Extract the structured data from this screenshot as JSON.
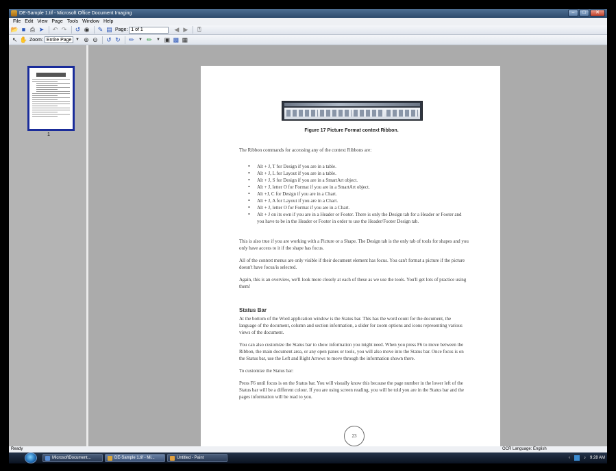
{
  "window": {
    "title": "DE-Sample 1.tif - Microsoft Office Document Imaging"
  },
  "menu": {
    "items": [
      "File",
      "Edit",
      "View",
      "Page",
      "Tools",
      "Window",
      "Help"
    ]
  },
  "toolbar1": {
    "page_label": "Page:",
    "page_value": "1 of 1"
  },
  "toolbar2": {
    "zoom_label": "Zoom:",
    "zoom_value": "Entire Page"
  },
  "thumbnail": {
    "page_number": "1"
  },
  "document": {
    "figure_caption": "Figure 17 Picture Format context Ribbon.",
    "intro": "The Ribbon commands for accessing any of the context Ribbons are:",
    "bullets": [
      "Alt + J, T for Design if you are in a table.",
      "Alt + J, L for Layout if you are in a table.",
      "Alt + J, S for Design if you are in a SmartArt object.",
      "Alt + J, letter O for Format if you are in a SmartArt object.",
      "Alt +J, C for Design if you are in a Chart.",
      "Alt + J, A for Layout if you are in a Chart.",
      "Alt + J, letter O for Format if you are in a Chart.",
      "Alt + J on its own if you are in a Header or Footer. There is only the Design tab for a Header or Footer and you have to be in the Header or Footer in order to use the Header/Footer Design tab."
    ],
    "para1": "This is also true if you are working with a Picture or a Shape. The Design tab is the only tab of tools for shapes and you only have access to it if the shape has focus.",
    "para2": "All of the context menus are only visible if their document element has focus. You can't format a picture if the picture doesn't have focus/is selected.",
    "para3": "Again, this is an overview, we'll look more closely at each of these as we use the tools. You'll get lots of practice using them!",
    "status_heading": "Status Bar",
    "para4": "At the bottom of the Word application window is the Status bar. This has the word count for the document, the language of the document, column and section information, a slider for zoom options and icons representing various views of the document.",
    "para5": "You can also customize the Status bar to show information you might need. When you press F6 to move between the Ribbon, the main document area, or any open panes or tools, you will also move into the Status bar. Once focus is on the Status bar, use the Left and Right Arrows to move through the information shown there.",
    "para6": "To customize the Status bar:",
    "para7": "Press F6 until focus is on the Status bar. You will visually know this because the page number in the lower left of the Status bar will be a different colour. If you are using screen reading, you will be told you are in the Status bar and the pages information will be read to you.",
    "page_number": "23"
  },
  "statusbar": {
    "ready": "Ready",
    "ocr_language": "OCR Language: English"
  },
  "taskbar": {
    "buttons": [
      "MicrosoftDocument...",
      "DE-Sample 1.tif - Mi...",
      "Untitled - Paint"
    ],
    "clock": "9:28 AM"
  },
  "colors": {
    "title_bar": "#3a5a80",
    "thumbnail_border": "#1a2c9a",
    "workspace": "#ababab"
  }
}
